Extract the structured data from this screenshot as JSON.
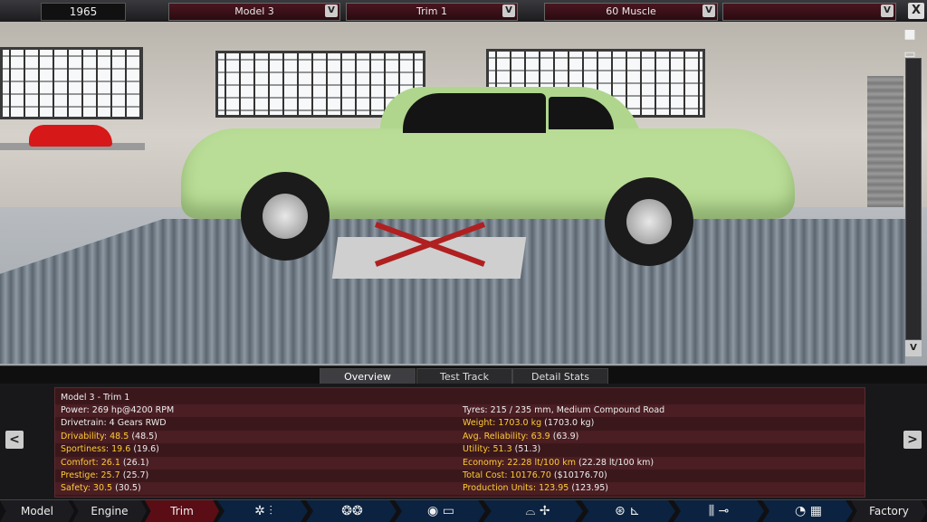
{
  "topbar": {
    "year": "1965",
    "model_label": "Model 3",
    "trim_label": "Trim 1",
    "body_label": "60 Muscle",
    "extra_label": "",
    "dropdown_glyph": "V",
    "close_glyph": "X"
  },
  "viewctrl": {
    "icons": [
      "camera-icon",
      "eye-icon",
      "car-front-icon",
      "car-side-icon",
      "car-front-icon",
      "car-top-icon"
    ],
    "scroll_glyph": "V"
  },
  "tabs": [
    "Overview",
    "Test Track",
    "Detail Stats"
  ],
  "stats": {
    "header": "Model 3 - Trim 1",
    "left": [
      {
        "label": "Power: 269 hp@4200 RPM",
        "paren": "",
        "color": "white"
      },
      {
        "label": "Drivetrain: 4 Gears RWD",
        "paren": "",
        "color": "white"
      },
      {
        "label": "Drivability: 48.5",
        "paren": "(48.5)",
        "color": "yellow"
      },
      {
        "label": "Sportiness: 19.6",
        "paren": "(19.6)",
        "color": "yellow"
      },
      {
        "label": "Comfort: 26.1",
        "paren": "(26.1)",
        "color": "yellow"
      },
      {
        "label": "Prestige: 25.7",
        "paren": "(25.7)",
        "color": "yellow"
      },
      {
        "label": "Safety: 30.5",
        "paren": "(30.5)",
        "color": "yellow"
      }
    ],
    "right": [
      {
        "label": "Tyres: 215 / 235 mm, Medium Compound Road",
        "paren": "",
        "color": "white"
      },
      {
        "label": "Weight: 1703.0 kg",
        "paren": "(1703.0 kg)",
        "color": "yellow"
      },
      {
        "label": "Avg. Reliability: 63.9",
        "paren": "(63.9)",
        "color": "yellow"
      },
      {
        "label": "Utility: 51.3",
        "paren": "(51.3)",
        "color": "yellow"
      },
      {
        "label": "Economy: 22.28 lt/100 km",
        "paren": "(22.28 lt/100 km)",
        "color": "yellow"
      },
      {
        "label": "Total Cost: 10176.70",
        "paren": "($10176.70)",
        "color": "yellow"
      },
      {
        "label": "Production Units: 123.95",
        "paren": "(123.95)",
        "color": "yellow"
      }
    ],
    "prev_glyph": "<",
    "next_glyph": ">"
  },
  "bottombar": {
    "model": "Model",
    "engine": "Engine",
    "trim": "Trim",
    "factory": "Factory",
    "icons": [
      "gearbox-icon",
      "wheel-icon",
      "chassis-icon",
      "car-body-icon",
      "fan-icon",
      "steering-icon",
      "seat-icon",
      "suspension-icon",
      "gauge-icon",
      "checkered-flag-icon"
    ]
  },
  "colors": {
    "accent_red": "#5a0d15",
    "panel_bg": "#3a171b",
    "stat_yellow": "#ffcc33",
    "car_green": "#b9dd96"
  }
}
